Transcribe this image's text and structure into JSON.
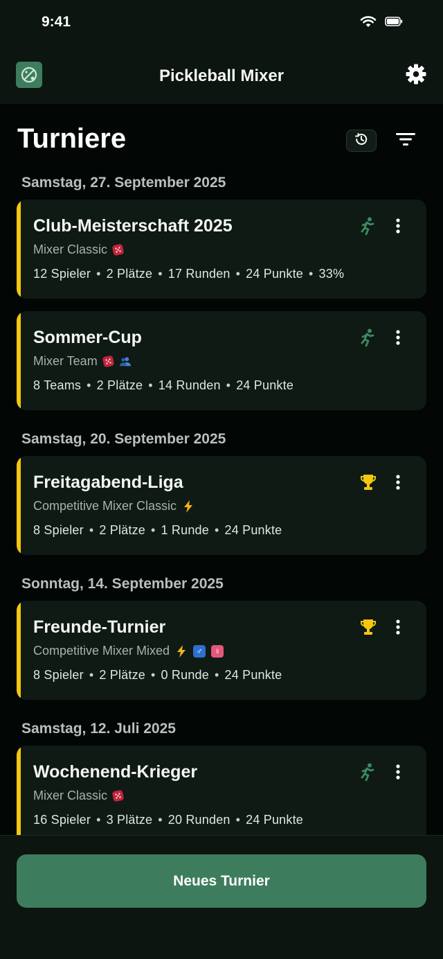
{
  "status_bar": {
    "time": "9:41"
  },
  "header": {
    "title": "Pickleball Mixer"
  },
  "page": {
    "title": "Turniere"
  },
  "groups": [
    {
      "date": "Samstag, 27. September 2025",
      "tournaments": [
        {
          "title": "Club-Meisterschaft 2025",
          "mode": "Mixer Classic",
          "badges": [
            "dice"
          ],
          "status": "running",
          "stats": [
            "12 Spieler",
            "2 Plätze",
            "17 Runden",
            "24 Punkte",
            "33%"
          ]
        },
        {
          "title": "Sommer-Cup",
          "mode": "Mixer Team",
          "badges": [
            "dice",
            "team"
          ],
          "status": "running",
          "stats": [
            "8 Teams",
            "2 Plätze",
            "14 Runden",
            "24 Punkte"
          ]
        }
      ]
    },
    {
      "date": "Samstag, 20. September 2025",
      "tournaments": [
        {
          "title": "Freitagabend-Liga",
          "mode": "Competitive Mixer Classic",
          "badges": [
            "bolt"
          ],
          "status": "finished",
          "stats": [
            "8 Spieler",
            "2 Plätze",
            "1 Runde",
            "24 Punkte"
          ]
        }
      ]
    },
    {
      "date": "Sonntag, 14. September 2025",
      "tournaments": [
        {
          "title": "Freunde-Turnier",
          "mode": "Competitive Mixer Mixed",
          "badges": [
            "bolt",
            "male",
            "female"
          ],
          "status": "finished",
          "stats": [
            "8 Spieler",
            "2 Plätze",
            "0 Runde",
            "24 Punkte"
          ]
        }
      ]
    },
    {
      "date": "Samstag, 12. Juli 2025",
      "tournaments": [
        {
          "title": "Wochenend-Krieger",
          "mode": "Mixer Classic",
          "badges": [
            "dice"
          ],
          "status": "running",
          "stats": [
            "16 Spieler",
            "3 Plätze",
            "20 Runden",
            "24 Punkte"
          ]
        }
      ]
    }
  ],
  "footer": {
    "new_button_label": "Neues Turnier"
  },
  "colors": {
    "accent": "#3d7d5e",
    "highlight": "#f4c70f",
    "background": "#020705",
    "card": "#0f1a14"
  },
  "icons": {
    "running": "running-icon",
    "finished": "trophy-icon",
    "more": "more-vertical-icon",
    "settings": "gear-icon",
    "history": "history-icon",
    "filter": "filter-icon"
  }
}
